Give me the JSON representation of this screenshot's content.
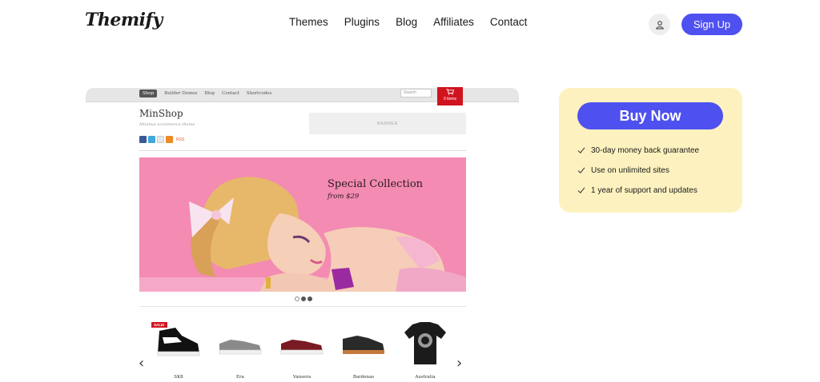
{
  "header": {
    "logo": "Themify",
    "nav": [
      "Themes",
      "Plugins",
      "Blog",
      "Affiliates",
      "Contact"
    ],
    "signup_label": "Sign Up",
    "user_icon": "user-icon"
  },
  "preview": {
    "menu": [
      "Shop",
      "Builder Demos",
      "Blog",
      "Contact",
      "Shortcodes"
    ],
    "search_placeholder": "Search",
    "cart_label": "0 items",
    "site_title": "MinShop",
    "tagline": "Minimal ecommerce theme",
    "rss_label": "RSS",
    "banner_label": "BANNER",
    "slide_title": "Special Collection",
    "slide_subtitle": "from $29",
    "slide_count": 3,
    "active_slide": 2,
    "sale_badge": "SALE!",
    "products": [
      "SK8",
      "Era",
      "Vansera",
      "Bardenas",
      "Australia"
    ],
    "colors": {
      "cart": "#d0141f",
      "slide_bg": "#f38bb2"
    }
  },
  "buy": {
    "button_label": "Buy Now",
    "features": [
      "30-day money back guarantee",
      "Use on unlimited sites",
      "1 year of support and updates"
    ],
    "colors": {
      "panel": "#fdf2bf",
      "accent": "#4f50f0"
    }
  }
}
